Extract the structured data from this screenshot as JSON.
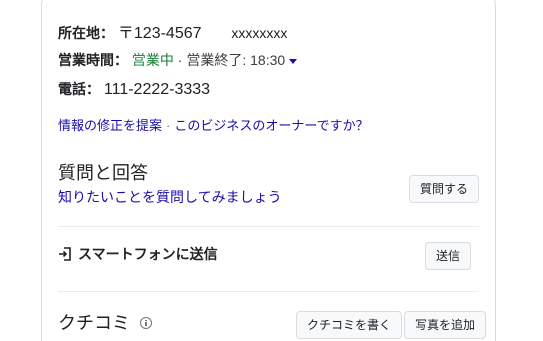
{
  "business": {
    "address_label": "所在地：",
    "address_postal": "〒123-4567",
    "address_text": "xxxxxxxx",
    "hours_label": "営業時間：",
    "hours_status": "営業中",
    "hours_separator": " · ",
    "hours_close": "営業終了: 18:30",
    "phone_label": "電話：",
    "phone_value": "111-2222-3333"
  },
  "links": {
    "suggest_edit": "情報の修正を提案",
    "separator": "·",
    "own_business": "このビジネスのオーナーですか？"
  },
  "qa": {
    "title": "質問と回答",
    "prompt": "知りたいことを質問してみましょう",
    "ask_button": "質問する"
  },
  "send_to_phone": {
    "label": "スマートフォンに送信",
    "icon": "send-to-phone-icon",
    "button": "送信"
  },
  "reviews": {
    "title": "クチコミ",
    "write_button": "クチコミを書く",
    "add_photo_button": "写真を追加"
  },
  "colors": {
    "link": "#1a0dab",
    "open": "#188038",
    "border": "#dadce0"
  }
}
